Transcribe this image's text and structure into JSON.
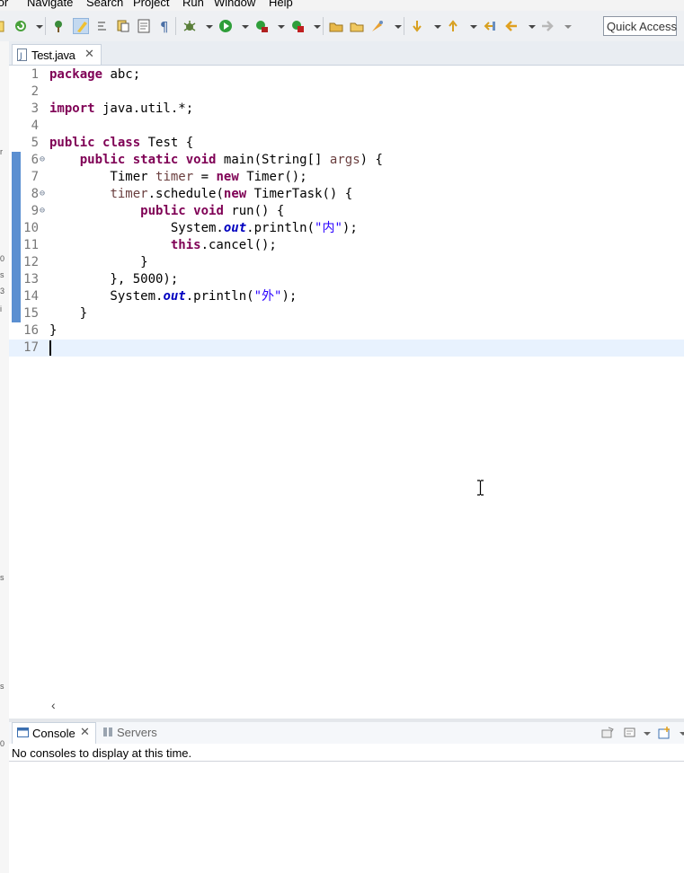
{
  "menu": [
    "tor",
    "Navigate",
    "Search",
    "Project",
    "Run",
    "Window",
    "Help"
  ],
  "quick_access": "Quick Access",
  "toolbar_icons": [
    "new-wizard-icon",
    "debug-icon",
    "run-icon",
    "coverage-icon",
    "external-tools-icon",
    "open-type-icon",
    "open-task-icon",
    "search-icon",
    "toggle-mark-occurrences-icon",
    "toggle-block-selection-icon",
    "show-whitespace-icon",
    "next-annotation-icon",
    "previous-annotation-icon",
    "last-edit-location-icon",
    "back-icon",
    "forward-icon"
  ],
  "editor": {
    "tab_label": "Test.java",
    "tab_close": "✕",
    "lines": [
      {
        "n": "1",
        "html": "<span class='kw'>package</span> abc;"
      },
      {
        "n": "2",
        "html": ""
      },
      {
        "n": "3",
        "html": "<span class='kw'>import</span> java.util.*;"
      },
      {
        "n": "4",
        "html": ""
      },
      {
        "n": "5",
        "html": "<span class='kw'>public</span> <span class='kw'>class</span> Test {"
      },
      {
        "n": "6",
        "fold": "⊖",
        "marker": true,
        "html": "    <span class='kw'>public</span> <span class='kw'>static</span> <span class='kw'>void</span> main(String[] <span class='var'>args</span>) {"
      },
      {
        "n": "7",
        "marker": true,
        "html": "        Timer <span class='var'>timer</span> = <span class='kw'>new</span> Timer();"
      },
      {
        "n": "8",
        "fold": "⊖",
        "marker": true,
        "html": "        <span class='var'>timer</span>.schedule(<span class='kw'>new</span> TimerTask() {"
      },
      {
        "n": "9",
        "fold": "⊖",
        "marker": true,
        "override": true,
        "html": "            <span class='kw'>public</span> <span class='kw'>void</span> run() {"
      },
      {
        "n": "10",
        "marker": true,
        "html": "                System.<span class='fld'>out</span>.println(<span class='str'>\"内\"</span>);"
      },
      {
        "n": "11",
        "marker": true,
        "html": "                <span class='kw'>this</span>.cancel();"
      },
      {
        "n": "12",
        "marker": true,
        "html": "            }"
      },
      {
        "n": "13",
        "marker": true,
        "html": "        }, 5000);"
      },
      {
        "n": "14",
        "marker": true,
        "html": "        System.<span class='fld'>out</span>.println(<span class='str'>\"外\"</span>);"
      },
      {
        "n": "15",
        "marker": true,
        "html": "    }"
      },
      {
        "n": "16",
        "html": "}"
      },
      {
        "n": "17",
        "html": "",
        "current": true
      }
    ],
    "hscroll_arrow": "‹"
  },
  "console": {
    "tab_label": "Console",
    "tab_close": "✕",
    "servers_label": "Servers",
    "message": "No consoles to display at this time."
  }
}
